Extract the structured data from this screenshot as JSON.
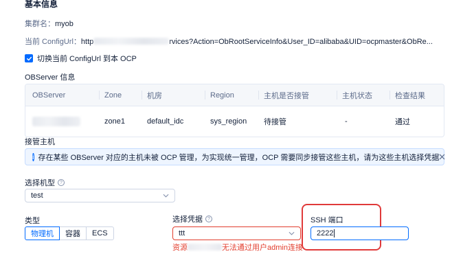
{
  "section_basic": {
    "title": "基本信息"
  },
  "cluster": {
    "label": "集群名：",
    "value": "myob"
  },
  "config_url": {
    "label": "当前 ConfigUrl：",
    "prefix": "http",
    "suffix": "rvices?Action=ObRootServiceInfo&User_ID=alibaba&UID=ocpmaster&ObRe..."
  },
  "switch_checkbox": {
    "label": "切换当前 ConfigUrl 到本 OCP",
    "checked": true
  },
  "observer_section": {
    "title": "OBServer 信息"
  },
  "table": {
    "headers": [
      "OBServer",
      "Zone",
      "机房",
      "Region",
      "主机是否接管",
      "主机状态",
      "检查结果"
    ],
    "rows": [
      {
        "observer": "",
        "zone": "zone1",
        "idc": "default_idc",
        "region": "sys_region",
        "managed": "待接管",
        "host_status": "-",
        "check_result": "通过"
      }
    ]
  },
  "takeover_section": {
    "title": "接管主机"
  },
  "alert": {
    "text": "存在某些 OBServer 对应的主机未被 OCP 管理，为实现统一管理，OCP 需要同步接管这些主机，请为这些主机选择凭据",
    "icon": "info-icon",
    "close_icon": "close-icon"
  },
  "model_select": {
    "label": "选择机型",
    "value": "test"
  },
  "type_group": {
    "label": "类型",
    "options": [
      "物理机",
      "容器",
      "ECS"
    ],
    "selected": "物理机"
  },
  "credential_select": {
    "label": "选择凭据",
    "value": "ttt",
    "error_prefix": "资源",
    "error_suffix": "无法通过用户admin连接"
  },
  "ssh_port": {
    "label": "SSH 端口",
    "value": "2222"
  },
  "colors": {
    "accent": "#006aff",
    "error": "#e23d2d",
    "highlight": "#e03a3a"
  }
}
